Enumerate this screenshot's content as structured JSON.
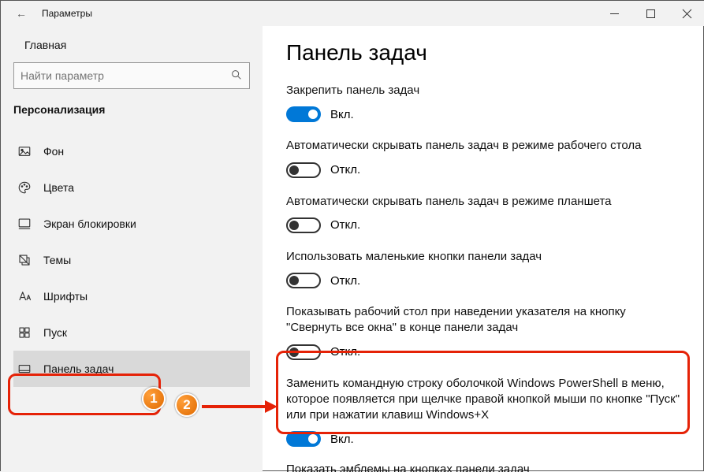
{
  "window": {
    "title": "Параметры"
  },
  "sidebar": {
    "home": "Главная",
    "search_placeholder": "Найти параметр",
    "section": "Персонализация",
    "items": [
      {
        "label": "Фон"
      },
      {
        "label": "Цвета"
      },
      {
        "label": "Экран блокировки"
      },
      {
        "label": "Темы"
      },
      {
        "label": "Шрифты"
      },
      {
        "label": "Пуск"
      },
      {
        "label": "Панель задач"
      }
    ]
  },
  "page": {
    "title": "Панель задач",
    "settings": [
      {
        "label": "Закрепить панель задач",
        "on": true,
        "state": "Вкл."
      },
      {
        "label": "Автоматически скрывать панель задач в режиме рабочего стола",
        "on": false,
        "state": "Откл."
      },
      {
        "label": "Автоматически скрывать панель задач в режиме планшета",
        "on": false,
        "state": "Откл."
      },
      {
        "label": "Использовать маленькие кнопки панели задач",
        "on": false,
        "state": "Откл."
      },
      {
        "label": "Показывать рабочий стол при наведении указателя на кнопку \"Свернуть все окна\" в конце панели задач",
        "on": false,
        "state": "Откл."
      },
      {
        "label": "Заменить командную строку оболочкой Windows PowerShell в меню, которое появляется при щелчке правой кнопкой мыши по кнопке \"Пуск\" или при нажатии клавиш Windows+X",
        "on": true,
        "state": "Вкл."
      }
    ],
    "cut_text": "Показать эмблемы на кнопках панели задач"
  },
  "annotations": {
    "badge1": "1",
    "badge2": "2"
  }
}
